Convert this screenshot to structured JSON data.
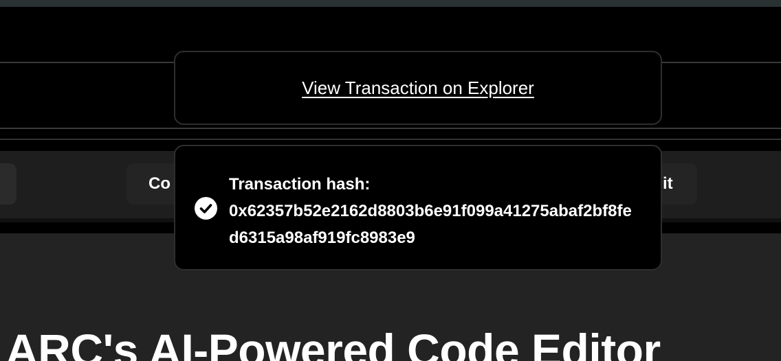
{
  "toasts": {
    "explorer_link_label": "View Transaction on Explorer",
    "hash_label": "Transaction hash:",
    "hash_value": "0x62357b52e2162d8803b6e91f099a41275abaf2bf8fed6315a98af919fc8983e9",
    "status_icon": "check-circle-icon"
  },
  "background": {
    "left_button_label": "Co",
    "right_button_label": "it",
    "headline": "ARC's AI-Powered Code Editor"
  },
  "colors": {
    "page_background": "#232323",
    "toast_background": "#000000",
    "toast_border": "#2e2e2e",
    "text": "#ffffff"
  }
}
